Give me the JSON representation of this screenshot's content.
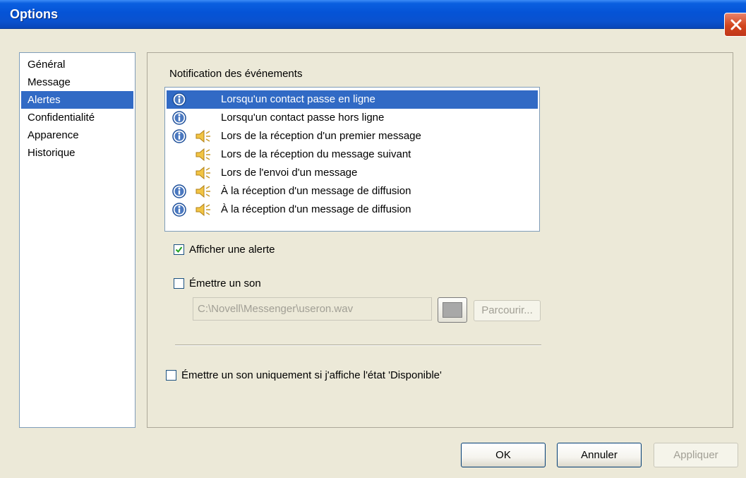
{
  "window": {
    "title": "Options",
    "titlebar_color": "#0553d6",
    "close_button_color": "#d2441c"
  },
  "nav": {
    "items": [
      {
        "label": "Général",
        "selected": false
      },
      {
        "label": "Message",
        "selected": false
      },
      {
        "label": "Alertes",
        "selected": true
      },
      {
        "label": "Confidentialité",
        "selected": false
      },
      {
        "label": "Apparence",
        "selected": false
      },
      {
        "label": "Historique",
        "selected": false
      }
    ]
  },
  "notifications": {
    "label": "Notification des événements",
    "events": [
      {
        "label": "Lorsqu'un contact passe en ligne",
        "info_icon": true,
        "sound_icon": false,
        "selected": true
      },
      {
        "label": "Lorsqu'un contact passe hors ligne",
        "info_icon": true,
        "sound_icon": false,
        "selected": false
      },
      {
        "label": "Lors de la réception d'un premier message",
        "info_icon": true,
        "sound_icon": true,
        "selected": false
      },
      {
        "label": "Lors de la réception du message suivant",
        "info_icon": false,
        "sound_icon": true,
        "selected": false
      },
      {
        "label": "Lors de l'envoi d'un message",
        "info_icon": false,
        "sound_icon": true,
        "selected": false
      },
      {
        "label": "À la réception d'un message de diffusion",
        "info_icon": true,
        "sound_icon": true,
        "selected": false
      },
      {
        "label": "À la réception d'un message de diffusion",
        "info_icon": true,
        "sound_icon": true,
        "selected": false
      }
    ]
  },
  "options": {
    "show_alert_label": "Afficher une alerte",
    "show_alert_checked": true,
    "play_sound_label": "Émettre un son",
    "play_sound_checked": false,
    "sound_file_value": "C:\\Novell\\Messenger\\useron.wav",
    "browse_label": "Parcourir...",
    "available_only_label": "Émettre un son uniquement si j'affiche l'état 'Disponible'",
    "available_only_checked": false
  },
  "buttons": {
    "ok_label": "OK",
    "cancel_label": "Annuler",
    "apply_label": "Appliquer"
  },
  "colors": {
    "selection": "#316ac5",
    "dialog_bg": "#ece9d8",
    "checkmark": "#21a121"
  }
}
